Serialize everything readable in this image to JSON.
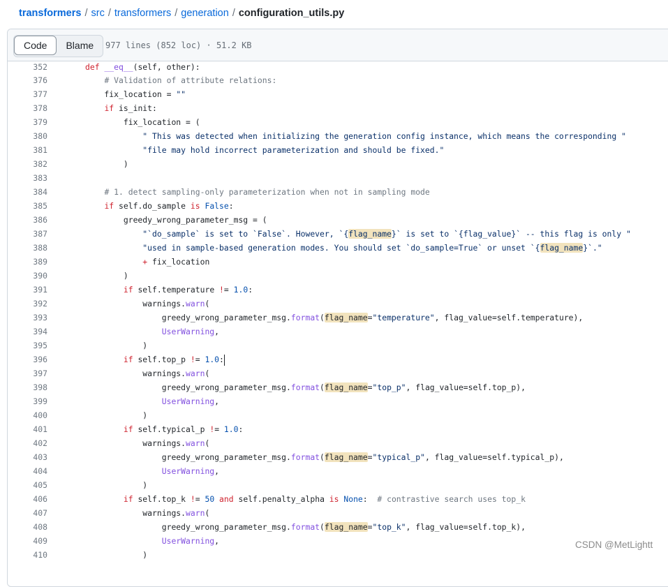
{
  "breadcrumb": {
    "root": "transformers",
    "seg1": "src",
    "seg2": "transformers",
    "seg3": "generation",
    "file": "configuration_utils.py",
    "sep": "/"
  },
  "toolbar": {
    "code_label": "Code",
    "blame_label": "Blame",
    "file_meta": "977 lines (852 loc) · 51.2 KB"
  },
  "sticky": {
    "line": "352",
    "text": "def __eq__(self, other):"
  },
  "lines": [
    {
      "n": "376",
      "text": "    # Validation of attribute relations:"
    },
    {
      "n": "377",
      "text": "    fix_location = \"\""
    },
    {
      "n": "378",
      "text": "    if is_init:"
    },
    {
      "n": "379",
      "text": "        fix_location = ("
    },
    {
      "n": "380",
      "text": "            \" This was detected when initializing the generation config instance, which means the corresponding \""
    },
    {
      "n": "381",
      "text": "            \"file may hold incorrect parameterization and should be fixed.\""
    },
    {
      "n": "382",
      "text": "        )"
    },
    {
      "n": "383",
      "text": ""
    },
    {
      "n": "384",
      "text": "    # 1. detect sampling-only parameterization when not in sampling mode"
    },
    {
      "n": "385",
      "text": "    if self.do_sample is False:"
    },
    {
      "n": "386",
      "text": "        greedy_wrong_parameter_msg = ("
    },
    {
      "n": "387",
      "text": "            \"`do_sample` is set to `False`. However, `{flag_name}` is set to `{flag_value}` -- this flag is only \""
    },
    {
      "n": "388",
      "text": "            \"used in sample-based generation modes. You should set `do_sample=True` or unset `{flag_name}`.\""
    },
    {
      "n": "389",
      "text": "            + fix_location"
    },
    {
      "n": "390",
      "text": "        )"
    },
    {
      "n": "391",
      "text": "        if self.temperature != 1.0:"
    },
    {
      "n": "392",
      "text": "            warnings.warn("
    },
    {
      "n": "393",
      "text": "                greedy_wrong_parameter_msg.format(flag_name=\"temperature\", flag_value=self.temperature),"
    },
    {
      "n": "394",
      "text": "                UserWarning,"
    },
    {
      "n": "395",
      "text": "            )"
    },
    {
      "n": "396",
      "text": "        if self.top_p != 1.0:"
    },
    {
      "n": "397",
      "text": "            warnings.warn("
    },
    {
      "n": "398",
      "text": "                greedy_wrong_parameter_msg.format(flag_name=\"top_p\", flag_value=self.top_p),"
    },
    {
      "n": "399",
      "text": "                UserWarning,"
    },
    {
      "n": "400",
      "text": "            )"
    },
    {
      "n": "401",
      "text": "        if self.typical_p != 1.0:"
    },
    {
      "n": "402",
      "text": "            warnings.warn("
    },
    {
      "n": "403",
      "text": "                greedy_wrong_parameter_msg.format(flag_name=\"typical_p\", flag_value=self.typical_p),"
    },
    {
      "n": "404",
      "text": "                UserWarning,"
    },
    {
      "n": "405",
      "text": "            )"
    },
    {
      "n": "406",
      "text": "        if self.top_k != 50 and self.penalty_alpha is None:  # contrastive search uses top_k"
    },
    {
      "n": "407",
      "text": "            warnings.warn("
    },
    {
      "n": "408",
      "text": "                greedy_wrong_parameter_msg.format(flag_name=\"top_k\", flag_value=self.top_k),"
    },
    {
      "n": "409",
      "text": "                UserWarning,"
    },
    {
      "n": "410",
      "text": "            )"
    }
  ],
  "highlight_word": "flag_name",
  "watermark": "CSDN @MetLightt",
  "colors": {
    "link": "#0969da",
    "keyword": "#cf222e",
    "function": "#8250df",
    "string": "#0a3069",
    "comment": "#6e7781",
    "number": "#0550ae",
    "highlight": "#f2e3bd"
  }
}
